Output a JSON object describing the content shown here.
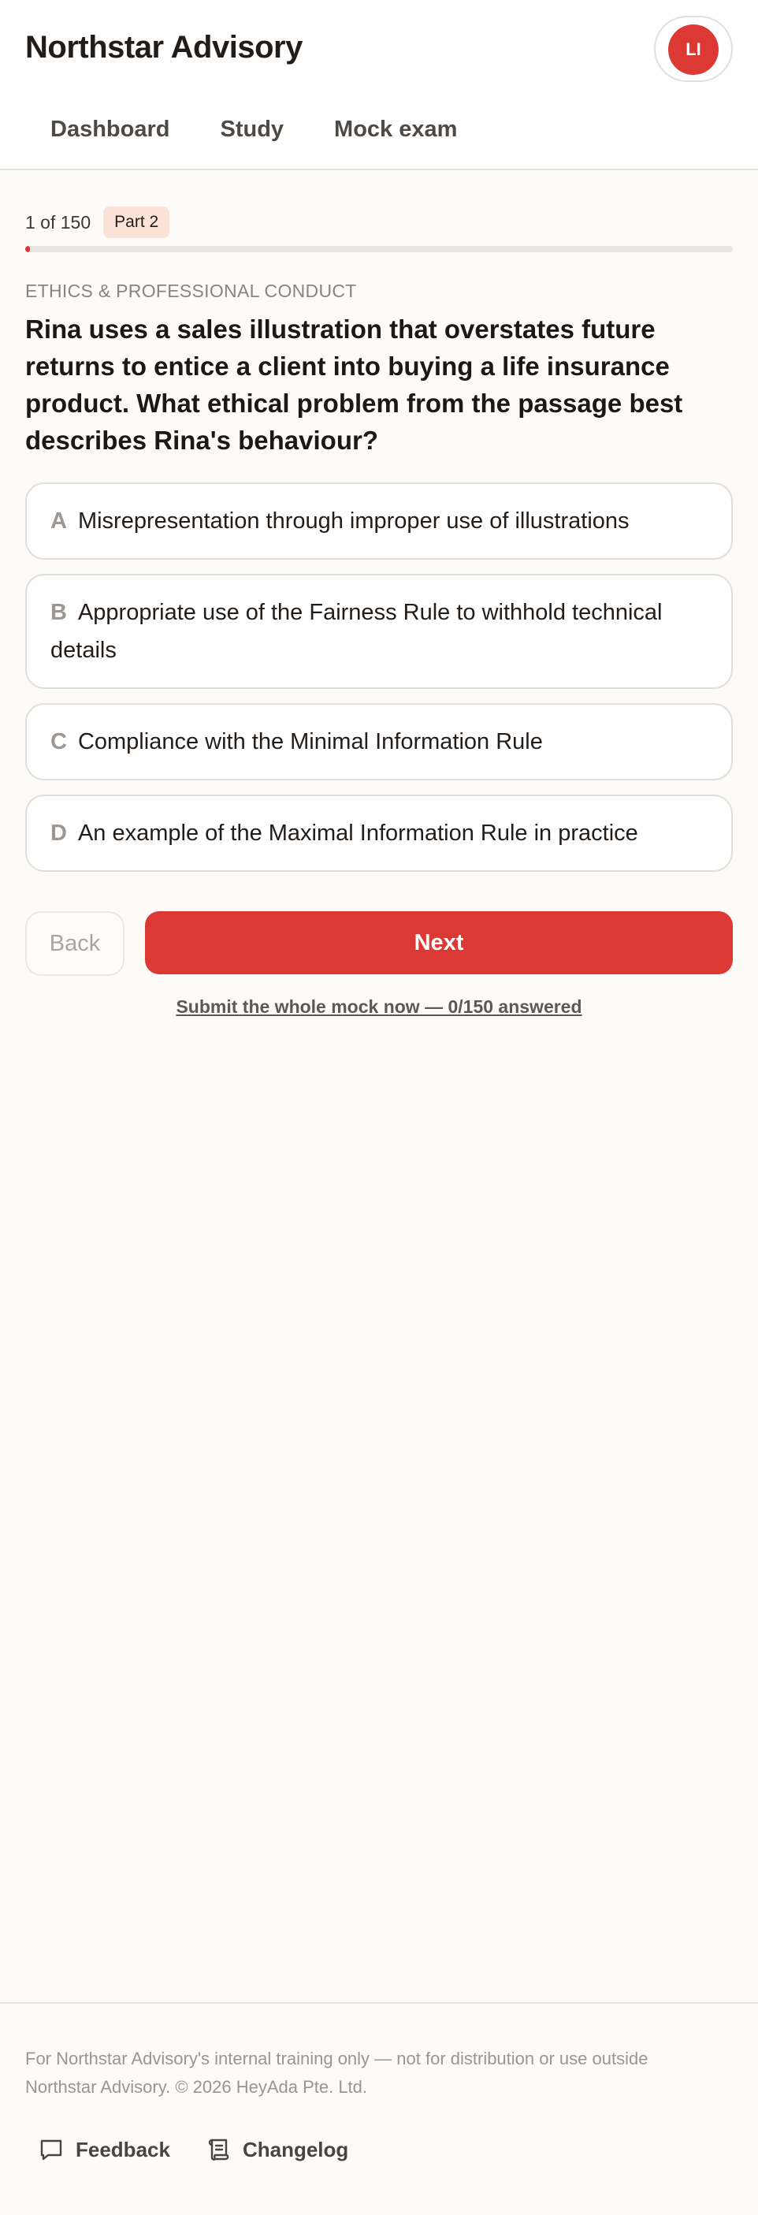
{
  "header": {
    "brand": "Northstar Advisory",
    "avatar_initials": "LI"
  },
  "nav": {
    "tabs": [
      {
        "label": "Dashboard"
      },
      {
        "label": "Study"
      },
      {
        "label": "Mock exam"
      }
    ]
  },
  "progress": {
    "count_text": "1 of 150",
    "part_badge": "Part 2",
    "current": 1,
    "total": 150
  },
  "question": {
    "section": "ETHICS & PROFESSIONAL CONDUCT",
    "text": "Rina uses a sales illustration that overstates future returns to entice a client into buying a life insurance product. What ethical problem from the passage best describes Rina's behaviour?",
    "options": [
      {
        "letter": "A",
        "text": "Misrepresentation through improper use of illustrations"
      },
      {
        "letter": "B",
        "text": "Appropriate use of the Fairness Rule to withhold technical details"
      },
      {
        "letter": "C",
        "text": "Compliance with the Minimal Information Rule"
      },
      {
        "letter": "D",
        "text": "An example of the Maximal Information Rule in practice"
      }
    ]
  },
  "actions": {
    "back_label": "Back",
    "next_label": "Next",
    "submit_label": "Submit the whole mock now — 0/150 answered"
  },
  "footer": {
    "note": "For Northstar Advisory's internal training only — not for distribution or use outside Northstar Advisory. © 2026 HeyAda Pte. Ltd.",
    "links": [
      {
        "label": "Feedback",
        "icon": "chat-bubble-icon"
      },
      {
        "label": "Changelog",
        "icon": "scroll-icon"
      }
    ]
  },
  "colors": {
    "accent": "#dc3834",
    "background": "#fcfbf8",
    "badge_bg": "#fbe3d8"
  }
}
